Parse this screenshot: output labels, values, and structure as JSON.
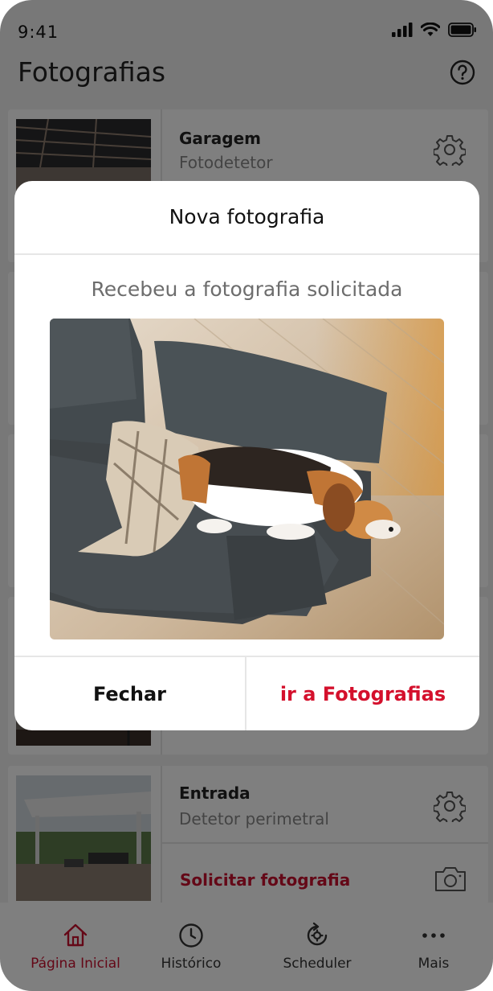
{
  "status_bar": {
    "time": "9:41"
  },
  "header": {
    "title": "Fotografias"
  },
  "cards": [
    {
      "name": "Garagem",
      "subtitle": "Fotodetetor"
    },
    {
      "name": "Entrada",
      "subtitle": "Detetor perimetral",
      "request_label": "Solicitar fotografia"
    }
  ],
  "bottom_nav": [
    {
      "label": "Página Inicial",
      "icon": "home-icon",
      "active": true
    },
    {
      "label": "Histórico",
      "icon": "clock-icon",
      "active": false
    },
    {
      "label": "Scheduler",
      "icon": "scheduler-icon",
      "active": false
    },
    {
      "label": "Mais",
      "icon": "more-icon",
      "active": false
    }
  ],
  "modal": {
    "title": "Nova fotografia",
    "message": "Recebeu a fotografia solicitada",
    "close_label": "Fechar",
    "go_label": "ir a Fotografias"
  },
  "colors": {
    "accent": "#c8102e",
    "overlay": "rgba(0,0,0,0.5)"
  }
}
